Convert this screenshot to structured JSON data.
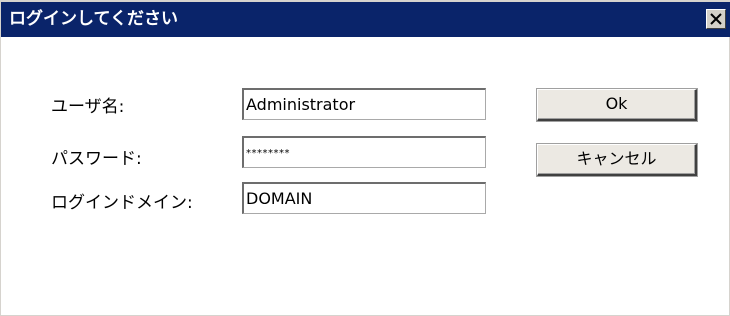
{
  "window": {
    "title": "ログインしてください",
    "close_symbol": "×"
  },
  "form": {
    "username": {
      "label": "ユーザ名:",
      "value": "Administrator"
    },
    "password": {
      "label": "パスワード:",
      "value": "********"
    },
    "domain": {
      "label": "ログインドメイン:",
      "value": "DOMAIN"
    }
  },
  "buttons": {
    "ok_label": "Ok",
    "cancel_label": "キャンセル"
  },
  "colors": {
    "titlebar": "#0a246a",
    "title_text": "#ffffff",
    "dialog_bg": "#ffffff",
    "button_face": "#ece9e3"
  },
  "icons": {
    "close": "close-icon"
  }
}
